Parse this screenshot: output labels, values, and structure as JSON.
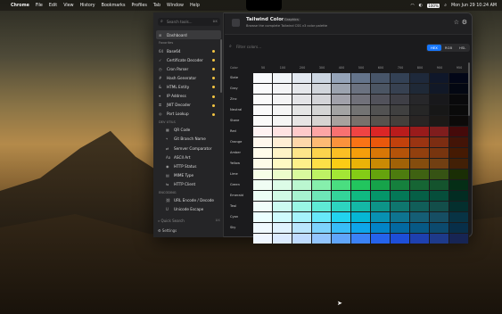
{
  "menubar": {
    "app": "Chrome",
    "items": [
      "File",
      "Edit",
      "View",
      "History",
      "Bookmarks",
      "Profiles",
      "Tab",
      "Window",
      "Help"
    ],
    "battery": "100%",
    "clock": "Mon Jun 29  10:24 AM"
  },
  "window": {
    "title": "Tailwind Colors",
    "badge": "Graphics",
    "subtitle": "Browse the complete Tailwind CSS v3 color palette"
  },
  "sidebar": {
    "search_placeholder": "Search tools...",
    "search_shortcut": "⌘K",
    "dashboard": "Dashboard",
    "sections": [
      {
        "label": "Favorites",
        "items": [
          {
            "icon": "64",
            "label": "Base64",
            "fav": true
          },
          {
            "icon": "✓",
            "label": "Certificate Decoder",
            "fav": true
          },
          {
            "icon": "◷",
            "label": "Cron Parser",
            "fav": true
          },
          {
            "icon": "#",
            "label": "Hash Generator",
            "fav": true
          },
          {
            "icon": "&",
            "label": "HTML Entity",
            "fav": true
          },
          {
            "icon": "⌖",
            "label": "IP Address",
            "fav": true
          },
          {
            "icon": "⚿",
            "label": "JWT Decoder",
            "fav": true
          },
          {
            "icon": "◎",
            "label": "Port Lookup",
            "fav": true
          }
        ]
      },
      {
        "label": "DEV UTILS",
        "items": [
          {
            "icon": "▦",
            "label": "QR Code",
            "fav": false
          },
          {
            "icon": "⑂",
            "label": "Git Branch Name",
            "fav": false
          },
          {
            "icon": "⇄",
            "label": "Semver Comparator",
            "fav": false
          },
          {
            "icon": "Aa",
            "label": "ASCII Art",
            "fav": false
          },
          {
            "icon": "◉",
            "label": "HTTP Status",
            "fav": false
          },
          {
            "icon": "▤",
            "label": "MIME Type",
            "fav": false
          },
          {
            "icon": "⇆",
            "label": "HTTP Client",
            "fav": false
          }
        ]
      },
      {
        "label": "ENCODING",
        "items": [
          {
            "icon": "⛓",
            "label": "URL Encode / Decode",
            "fav": false
          },
          {
            "icon": "U",
            "label": "Unicode Escape",
            "fav": false
          }
        ]
      }
    ],
    "quick_search": "Quick Search",
    "quick_shortcut": "⌘K",
    "settings": "Settings"
  },
  "content": {
    "filter_placeholder": "Filter colors...",
    "formats": [
      "HEX",
      "RGB",
      "HSL"
    ],
    "active_format": "HEX",
    "header_label": "Color",
    "shades": [
      "50",
      "100",
      "200",
      "300",
      "400",
      "500",
      "600",
      "700",
      "800",
      "900",
      "950"
    ],
    "palette": [
      {
        "name": "Slate",
        "colors": [
          "#f8fafc",
          "#f1f5f9",
          "#e2e8f0",
          "#cbd5e1",
          "#94a3b8",
          "#64748b",
          "#475569",
          "#334155",
          "#1e293b",
          "#0f172a",
          "#020617"
        ]
      },
      {
        "name": "Gray",
        "colors": [
          "#f9fafb",
          "#f3f4f6",
          "#e5e7eb",
          "#d1d5db",
          "#9ca3af",
          "#6b7280",
          "#4b5563",
          "#374151",
          "#1f2937",
          "#111827",
          "#030712"
        ]
      },
      {
        "name": "Zinc",
        "colors": [
          "#fafafa",
          "#f4f4f5",
          "#e4e4e7",
          "#d4d4d8",
          "#a1a1aa",
          "#71717a",
          "#52525b",
          "#3f3f46",
          "#27272a",
          "#18181b",
          "#09090b"
        ]
      },
      {
        "name": "Neutral",
        "colors": [
          "#fafafa",
          "#f5f5f5",
          "#e5e5e5",
          "#d4d4d4",
          "#a3a3a3",
          "#737373",
          "#525252",
          "#404040",
          "#262626",
          "#171717",
          "#0a0a0a"
        ]
      },
      {
        "name": "Stone",
        "colors": [
          "#fafaf9",
          "#f5f5f4",
          "#e7e5e4",
          "#d6d3d1",
          "#a8a29e",
          "#78716c",
          "#57534e",
          "#44403c",
          "#292524",
          "#1c1917",
          "#0c0a09"
        ]
      },
      {
        "name": "Red",
        "colors": [
          "#fef2f2",
          "#fee2e2",
          "#fecaca",
          "#fca5a5",
          "#f87171",
          "#ef4444",
          "#dc2626",
          "#b91c1c",
          "#991b1b",
          "#7f1d1d",
          "#450a0a"
        ]
      },
      {
        "name": "Orange",
        "colors": [
          "#fff7ed",
          "#ffedd5",
          "#fed7aa",
          "#fdba74",
          "#fb923c",
          "#f97316",
          "#ea580c",
          "#c2410c",
          "#9a3412",
          "#7c2d12",
          "#431407"
        ]
      },
      {
        "name": "Amber",
        "colors": [
          "#fffbeb",
          "#fef3c7",
          "#fde68a",
          "#fcd34d",
          "#fbbf24",
          "#f59e0b",
          "#d97706",
          "#b45309",
          "#92400e",
          "#78350f",
          "#451a03"
        ]
      },
      {
        "name": "Yellow",
        "colors": [
          "#fefce8",
          "#fef9c3",
          "#fef08a",
          "#fde047",
          "#facc15",
          "#eab308",
          "#ca8a04",
          "#a16207",
          "#854d0e",
          "#713f12",
          "#422006"
        ]
      },
      {
        "name": "Lime",
        "colors": [
          "#f7fee7",
          "#ecfccb",
          "#d9f99d",
          "#bef264",
          "#a3e635",
          "#84cc16",
          "#65a30d",
          "#4d7c0f",
          "#3f6212",
          "#365314",
          "#1a2e05"
        ]
      },
      {
        "name": "Green",
        "colors": [
          "#f0fdf4",
          "#dcfce7",
          "#bbf7d0",
          "#86efac",
          "#4ade80",
          "#22c55e",
          "#16a34a",
          "#15803d",
          "#166534",
          "#14532d",
          "#052e16"
        ]
      },
      {
        "name": "Emerald",
        "colors": [
          "#ecfdf5",
          "#d1fae5",
          "#a7f3d0",
          "#6ee7b7",
          "#34d399",
          "#10b981",
          "#059669",
          "#047857",
          "#065f46",
          "#064e3b",
          "#022c22"
        ]
      },
      {
        "name": "Teal",
        "colors": [
          "#f0fdfa",
          "#ccfbf1",
          "#99f6e4",
          "#5eead4",
          "#2dd4bf",
          "#14b8a6",
          "#0d9488",
          "#0f766e",
          "#115e59",
          "#134e4a",
          "#042f2e"
        ]
      },
      {
        "name": "Cyan",
        "colors": [
          "#ecfeff",
          "#cffafe",
          "#a5f3fc",
          "#67e8f9",
          "#22d3ee",
          "#06b6d4",
          "#0891b2",
          "#0e7490",
          "#155e75",
          "#164e63",
          "#083344"
        ]
      },
      {
        "name": "Sky",
        "colors": [
          "#f0f9ff",
          "#e0f2fe",
          "#bae6fd",
          "#7dd3fc",
          "#38bdf8",
          "#0ea5e9",
          "#0284c7",
          "#0369a1",
          "#075985",
          "#0c4a6e",
          "#082f49"
        ]
      },
      {
        "name": "",
        "colors": [
          "#eff6ff",
          "#dbeafe",
          "#bfdbfe",
          "#93c5fd",
          "#60a5fa",
          "#3b82f6",
          "#2563eb",
          "#1d4ed8",
          "#1e40af",
          "#1e3a8a",
          "#172554"
        ]
      }
    ]
  }
}
